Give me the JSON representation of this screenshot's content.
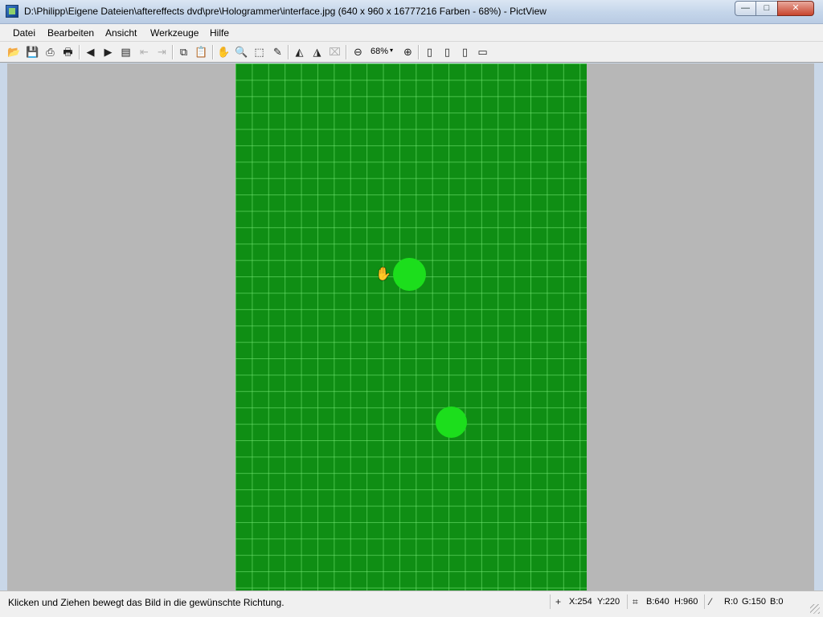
{
  "window": {
    "title": "D:\\Philipp\\Eigene Dateien\\aftereffects dvd\\pre\\Hologrammer\\interface.jpg (640 x 960 x 16777216 Farben - 68%) - PictView",
    "app_icon": "pictview-icon"
  },
  "window_controls": {
    "minimize": "—",
    "maximize": "□",
    "close": "✕"
  },
  "menu": {
    "items": [
      "Datei",
      "Bearbeiten",
      "Ansicht",
      "Werkzeuge",
      "Hilfe"
    ]
  },
  "toolbar": {
    "open_icon": "📂",
    "save_icon": "💾",
    "export_icon": "⎙",
    "print_icon": "🖶",
    "prev_icon": "◀",
    "next_icon": "▶",
    "page_icon": "▤",
    "back_icon": "⇤",
    "forward_icon": "⇥",
    "copy_icon": "⧉",
    "paste_icon": "📋",
    "hand_icon": "✋",
    "magnifier_icon": "🔍",
    "select_icon": "⬚",
    "eyedropper_icon": "✎",
    "rotate_left_icon": "◭",
    "rotate_right_icon": "◮",
    "crop_icon": "⌧",
    "zoom_out_icon": "⊖",
    "zoom_value": "68%",
    "zoom_caret": "▾",
    "zoom_in_icon": "⊕",
    "view1_icon": "▯",
    "view2_icon": "▯",
    "view3_icon": "▯",
    "view4_icon": "▭"
  },
  "status": {
    "message": "Klicken und Ziehen bewegt das Bild in die gewünschte Richtung.",
    "cursor_icon": "+",
    "x": "X:254",
    "y": "Y:220",
    "size_icon": "⌗",
    "width": "B:640",
    "height": "H:960",
    "picker_icon": "⁄",
    "r": "R:0",
    "g": "G:150",
    "b": "B:0"
  },
  "image_colors": {
    "background": "#0f8e14",
    "grid": "#78eb78",
    "dots": "#1cde1c",
    "viewport": "#b7b7b7"
  }
}
